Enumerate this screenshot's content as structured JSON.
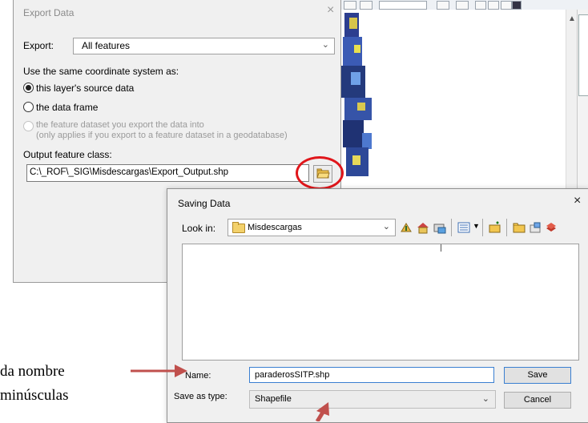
{
  "export_dialog": {
    "title": "Export Data",
    "close_glyph": "×",
    "export_label": "Export:",
    "export_value": "All features",
    "coord_label": "Use the same coordinate system as:",
    "options": [
      "this layer's source data",
      "the data frame",
      "the feature dataset you export the data into",
      "(only applies if you export to a feature dataset in a geodatabase)"
    ],
    "output_label": "Output feature class:",
    "output_path": "C:\\_ROF\\_SIG\\Misdescargas\\Export_Output.shp"
  },
  "saving_dialog": {
    "title": "Saving Data",
    "close_glyph": "×",
    "look_in_label": "Look in:",
    "look_in_value": "Misdescargas",
    "name_label": "Name:",
    "name_value": "paraderosSITP.shp",
    "type_label": "Save as type:",
    "type_value": "Shapefile",
    "save_label": "Save",
    "cancel_label": "Cancel"
  },
  "annotations": {
    "line1": "da nombre",
    "line2": "minúsculas"
  },
  "colors": {
    "annotation_red": "#c0504d",
    "highlight_ring": "#e0161b",
    "focus_blue": "#3a7fd1"
  }
}
